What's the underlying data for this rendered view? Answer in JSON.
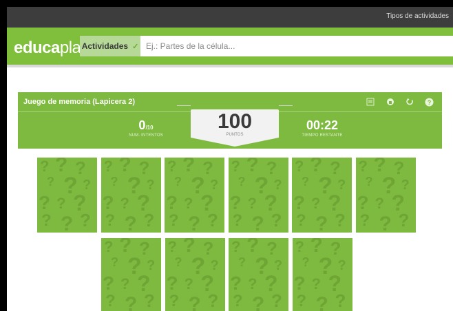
{
  "topbar": {
    "link_label": "Tipos de actividades"
  },
  "header": {
    "logo_bold": "educa",
    "logo_light": "play",
    "activities_label": "Actividades",
    "search_placeholder": "Ej.: Partes de la célula..."
  },
  "game": {
    "title": "Juego de memoria (Lapicera 2)",
    "tools": [
      "screen-icon",
      "sound-icon",
      "restart-icon",
      "help-icon"
    ],
    "attempts_value": "0",
    "attempts_total": "/10",
    "attempts_label": "NUM. INTENTOS",
    "score_value": "100",
    "score_label": "PUNTOS",
    "time_value": "00:22",
    "time_label": "TIEMPO RESTANTE"
  },
  "cards": {
    "row1_count": 6,
    "row2_count": 4
  },
  "colors": {
    "brand_green": "#7fbf3b",
    "card_green": "#7dba3f",
    "topbar": "#3d3d3d"
  }
}
